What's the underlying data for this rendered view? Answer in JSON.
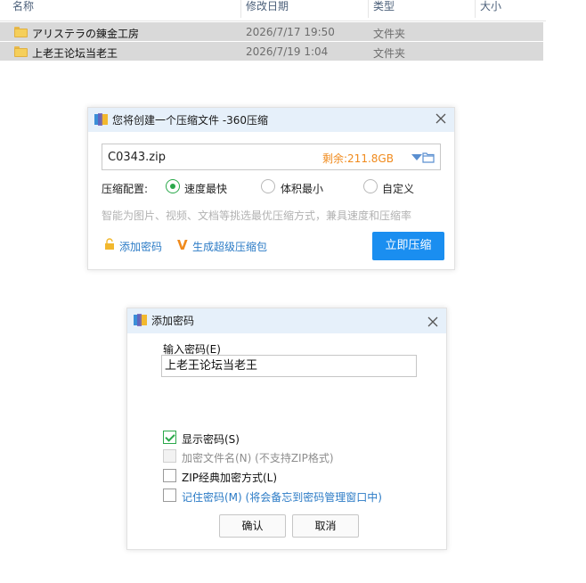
{
  "explorer": {
    "columns": {
      "name": "名称",
      "modified": "修改日期",
      "type": "类型",
      "size": "大小"
    },
    "rows": [
      {
        "name": "アリステラの錬金工房",
        "modified": "2026/7/17 19:50",
        "type": "文件夹"
      },
      {
        "name": "上老王论坛当老王",
        "modified": "2026/7/19 1:04",
        "type": "文件夹"
      }
    ]
  },
  "compress_dialog": {
    "title": "您将创建一个压缩文件 -360压缩",
    "path": "C0343.zip",
    "free_space": "剩余:211.8GB",
    "config_label": "压缩配置:",
    "options": [
      {
        "label": "速度最快",
        "selected": true
      },
      {
        "label": "体积最小",
        "selected": false
      },
      {
        "label": "自定义",
        "selected": false
      }
    ],
    "hint": "智能为图片、视频、文档等挑选最优压缩方式，兼具速度和压缩率",
    "add_password_link": "添加密码",
    "super_package_link": "生成超级压缩包",
    "compress_button": "立即压缩",
    "accent_color": "#1a8ef0",
    "free_space_color": "#f08a1c"
  },
  "password_dialog": {
    "title": "添加密码",
    "input_label": "输入密码(E)",
    "password_value": "上老王论坛当老王",
    "checkboxes": [
      {
        "label": "显示密码(S)",
        "checked": true,
        "disabled": false
      },
      {
        "label": "加密文件名(N) (不支持ZIP格式)",
        "checked": false,
        "disabled": true
      },
      {
        "label": "ZIP经典加密方式(L)",
        "checked": false,
        "disabled": false
      },
      {
        "label": "记住密码(M) (将会备忘到密码管理窗口中)",
        "checked": false,
        "disabled": false
      }
    ],
    "ok_button": "确认",
    "cancel_button": "取消",
    "check_color": "#2aa84a"
  }
}
